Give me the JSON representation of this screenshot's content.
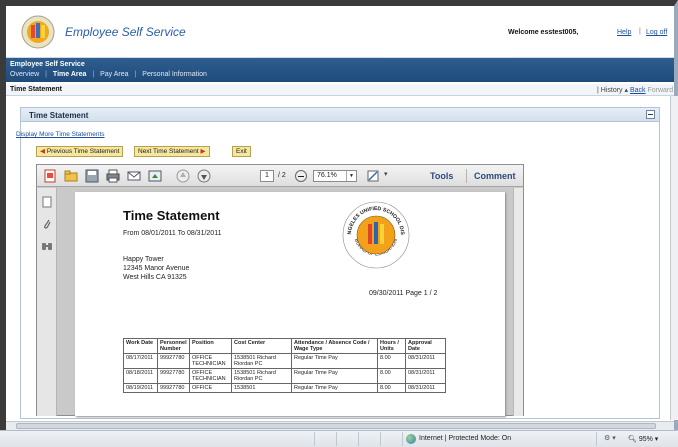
{
  "header": {
    "app_title": "Employee Self Service",
    "welcome_text": "Welcome esstest005,",
    "help_link": "Help",
    "logoff_link": "Log off"
  },
  "nav": {
    "title": "Employee Self Service",
    "items": [
      {
        "label": "Overview"
      },
      {
        "label": "Time Area"
      },
      {
        "label": "Pay Area"
      },
      {
        "label": "Personal Information"
      }
    ]
  },
  "page_bar": {
    "title": "Time Statement",
    "history": "History",
    "back": "Back",
    "forward": "Forward"
  },
  "content": {
    "section_title": "Time Statement",
    "display_more": "Display More Time Statements",
    "prev_button": "Previous Time Statement",
    "next_button": "Next Time Statement",
    "exit_button": "Exit"
  },
  "pdf_viewer": {
    "current_page": "1",
    "total_pages": "/ 2",
    "zoom": "76.1%",
    "tools_label": "Tools",
    "comment_label": "Comment",
    "toolbar_icons": [
      "create-pdf-icon",
      "open-icon",
      "save-icon",
      "print-icon",
      "email-icon",
      "share-icon",
      "prev-page-icon",
      "next-page-icon"
    ],
    "side_icons": [
      "pages-icon",
      "attachments-icon",
      "search-icon"
    ]
  },
  "document": {
    "title": "Time Statement",
    "period": "From 08/01/2011  To 08/31/2011",
    "address": [
      "Happy Tower",
      "12345 Manor Avenue",
      "West Hills CA  91325"
    ],
    "date_page": "09/30/2011 Page 1 /  2",
    "seal_text_top": "LOS ANGELES UNIFIED SCHOOL DISTRICT",
    "seal_text_bottom": "BOARD OF EDUCATION",
    "table": {
      "headers": [
        "Work Date",
        "Personnel Number",
        "Position",
        "Cost Center",
        "Attendance / Absence Code / Wage Type",
        "Hours / Units",
        "Approval Date"
      ],
      "rows": [
        [
          "08/17/2011",
          "99927780",
          "OFFICE TECHNICIAN",
          "1538501 Richard Riordan PC",
          "Regular Time Pay",
          "8.00",
          "08/31/2011"
        ],
        [
          "08/18/2011",
          "99927780",
          "OFFICE TECHNICIAN",
          "1538501 Richard Riordan PC",
          "Regular Time Pay",
          "8.00",
          "08/31/2011"
        ],
        [
          "08/19/2011",
          "99927780",
          "OFFICE",
          "1538501",
          "Regular Time Pay",
          "8.00",
          "08/31/2011"
        ]
      ]
    }
  },
  "statusbar": {
    "zone": "Internet | Protected Mode: On",
    "zoom": "95%"
  },
  "colors": {
    "nav_bg": "#1f4b7a",
    "button_yellow": "#f5e6a0",
    "link_blue": "#1d4fa0"
  }
}
